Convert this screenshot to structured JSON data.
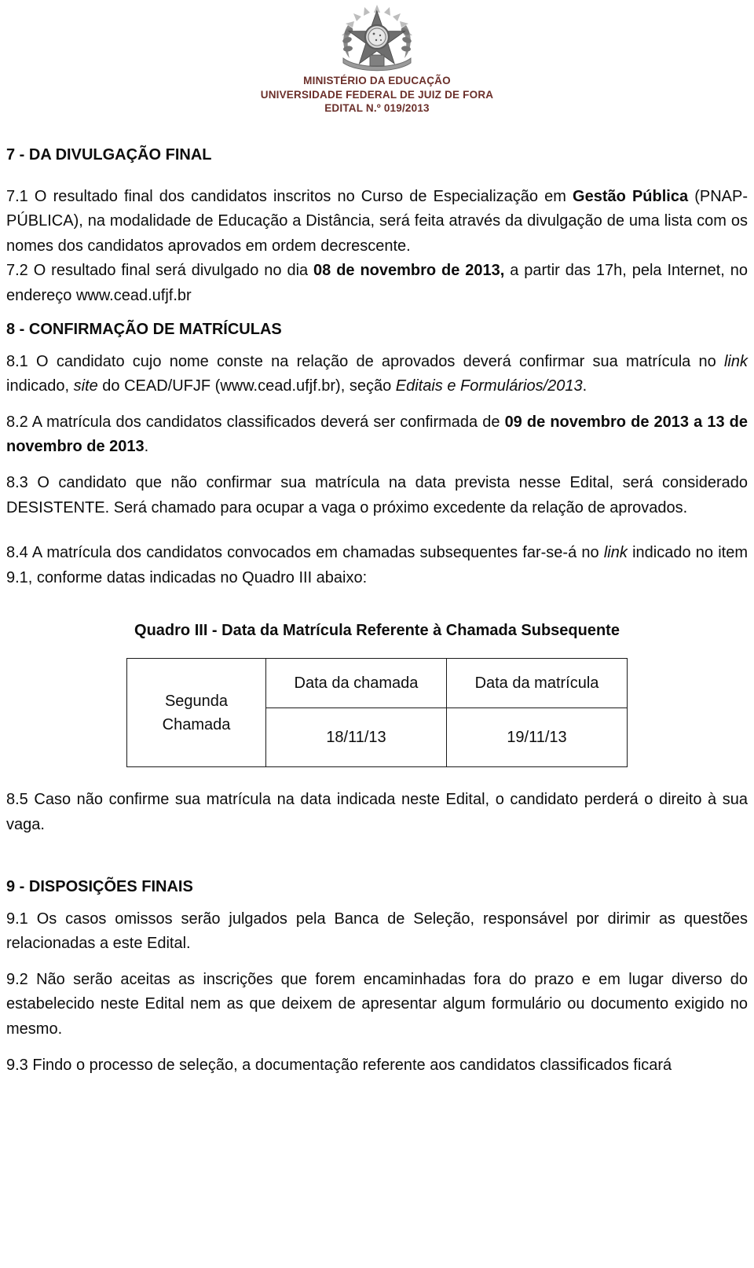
{
  "header": {
    "emblem_alt": "brazilian-coat-of-arms",
    "line1": "MINISTÉRIO DA EDUCAÇÃO",
    "line2": "UNIVERSIDADE FEDERAL DE JUIZ DE FORA",
    "line3": "EDITAL N.º 019/2013",
    "color": "#6b2f2a"
  },
  "sections": {
    "s7_title": "7 - DA DIVULGAÇÃO FINAL",
    "s8_title": "8 - CONFIRMAÇÃO DE MATRÍCULAS",
    "s9_title": "9 - DISPOSIÇÕES FINAIS"
  },
  "paragraphs": {
    "p71_a": "7.1 O resultado final dos candidatos inscritos no Curso de Especialização em ",
    "p71_bold": "Gestão Pública",
    "p71_b": " (PNAP-PÚBLICA), na modalidade de Educação a Distância, será feita através da divulgação de uma lista com os nomes dos candidatos aprovados em ordem decrescente.",
    "p72_a": "7.2 O resultado final será divulgado no dia ",
    "p72_bold": "08 de novembro de 2013,",
    "p72_b": " a partir das 17h, pela Internet, no endereço www.cead.ufjf.br",
    "p81_a": "8.1 O candidato cujo nome conste na relação de aprovados deverá confirmar sua matrícula no ",
    "p81_i1": "link",
    "p81_b": " indicado, ",
    "p81_i2": "site",
    "p81_c": " do CEAD/UFJF (www.cead.ufjf.br), seção ",
    "p81_i3": "Editais e Formulários/2013",
    "p81_d": ".",
    "p82_a": "8.2 A matrícula dos candidatos classificados deverá ser confirmada de ",
    "p82_bold": "09 de novembro de 2013 a 13 de novembro de 2013",
    "p82_b": ".",
    "p83": "8.3 O candidato que não confirmar sua matrícula na data prevista nesse Edital, será considerado DESISTENTE. Será chamado para ocupar a vaga o próximo excedente da relação de aprovados.",
    "p84_a": "8.4 A matrícula dos candidatos convocados em chamadas subsequentes far-se-á no ",
    "p84_i": "link",
    "p84_b": " indicado no item 9.1, conforme datas indicadas no Quadro III abaixo:",
    "p85": "8.5 Caso não confirme sua matrícula na data indicada neste Edital, o candidato perderá o direito à sua vaga.",
    "p91": "9.1 Os casos omissos serão julgados pela Banca de Seleção, responsável por dirimir as questões relacionadas a este Edital.",
    "p92": "9.2 Não serão aceitas as inscrições que forem encaminhadas fora do prazo e em lugar diverso do estabelecido neste Edital nem as que deixem de apresentar algum formulário ou documento exigido no mesmo.",
    "p93": "9.3 Findo o processo de seleção, a documentação referente aos candidatos classificados ficará"
  },
  "quadro3": {
    "title": "Quadro III - Data da Matrícula Referente à Chamada Subsequente",
    "row_label_line1": "Segunda",
    "row_label_line2": "Chamada",
    "headers": [
      "Data da chamada",
      "Data da matrícula"
    ],
    "values": [
      "18/11/13",
      "19/11/13"
    ]
  }
}
